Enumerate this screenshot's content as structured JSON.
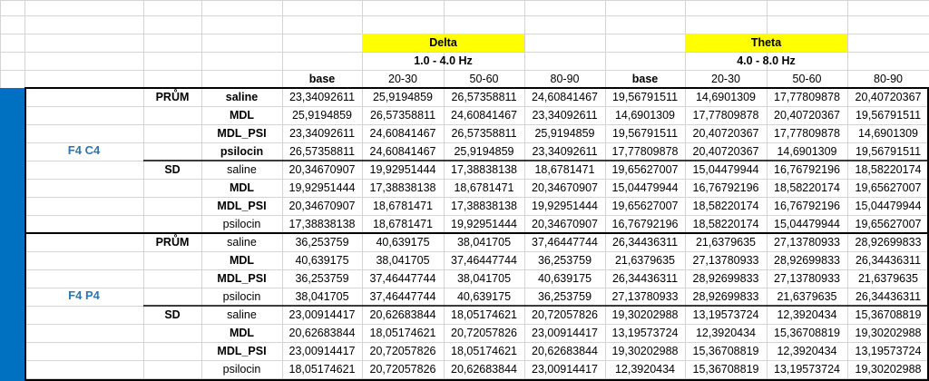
{
  "table": {
    "groups": [
      {
        "label": "Delta",
        "range": "1.0 - 4.0 Hz"
      },
      {
        "label": "Theta",
        "range": "4.0 - 8.0 Hz"
      }
    ],
    "columns": [
      "base",
      "20-30",
      "50-60",
      "80-90",
      "base",
      "20-30",
      "50-60",
      "80-90"
    ],
    "regions": [
      {
        "label": "F4 C4",
        "blocks": [
          {
            "stat": "PRŮM",
            "rows": [
              {
                "label": "saline",
                "values": [
                  "23,34092611",
                  "25,9194859",
                  "26,57358811",
                  "24,60841467",
                  "19,56791511",
                  "14,6901309",
                  "17,77809878",
                  "20,40720367"
                ]
              },
              {
                "label": "MDL",
                "values": [
                  "25,9194859",
                  "26,57358811",
                  "24,60841467",
                  "23,34092611",
                  "14,6901309",
                  "17,77809878",
                  "20,40720367",
                  "19,56791511"
                ]
              },
              {
                "label": "MDL_PSI",
                "values": [
                  "23,34092611",
                  "24,60841467",
                  "26,57358811",
                  "25,9194859",
                  "19,56791511",
                  "20,40720367",
                  "17,77809878",
                  "14,6901309"
                ]
              },
              {
                "label": "psilocin",
                "values": [
                  "26,57358811",
                  "24,60841467",
                  "25,9194859",
                  "23,34092611",
                  "17,77809878",
                  "20,40720367",
                  "14,6901309",
                  "19,56791511"
                ]
              }
            ]
          },
          {
            "stat": "SD",
            "rows": [
              {
                "label": "saline",
                "values": [
                  "20,34670907",
                  "19,92951444",
                  "17,38838138",
                  "18,6781471",
                  "19,65627007",
                  "15,04479944",
                  "16,76792196",
                  "18,58220174"
                ]
              },
              {
                "label": "MDL",
                "values": [
                  "19,92951444",
                  "17,38838138",
                  "18,6781471",
                  "20,34670907",
                  "15,04479944",
                  "16,76792196",
                  "18,58220174",
                  "19,65627007"
                ]
              },
              {
                "label": "MDL_PSI",
                "values": [
                  "20,34670907",
                  "18,6781471",
                  "17,38838138",
                  "19,92951444",
                  "19,65627007",
                  "18,58220174",
                  "16,76792196",
                  "15,04479944"
                ]
              },
              {
                "label": "psilocin",
                "values": [
                  "17,38838138",
                  "18,6781471",
                  "19,92951444",
                  "20,34670907",
                  "16,76792196",
                  "18,58220174",
                  "15,04479944",
                  "19,65627007"
                ]
              }
            ]
          }
        ]
      },
      {
        "label": "F4 P4",
        "blocks": [
          {
            "stat": "PRŮM",
            "rows": [
              {
                "label": "saline",
                "values": [
                  "36,253759",
                  "40,639175",
                  "38,041705",
                  "37,46447744",
                  "26,34436311",
                  "21,6379635",
                  "27,13780933",
                  "28,92699833"
                ]
              },
              {
                "label": "MDL",
                "values": [
                  "40,639175",
                  "38,041705",
                  "37,46447744",
                  "36,253759",
                  "21,6379635",
                  "27,13780933",
                  "28,92699833",
                  "26,34436311"
                ]
              },
              {
                "label": "MDL_PSI",
                "values": [
                  "36,253759",
                  "37,46447744",
                  "38,041705",
                  "40,639175",
                  "26,34436311",
                  "28,92699833",
                  "27,13780933",
                  "21,6379635"
                ]
              },
              {
                "label": "psilocin",
                "values": [
                  "38,041705",
                  "37,46447744",
                  "40,639175",
                  "36,253759",
                  "27,13780933",
                  "28,92699833",
                  "21,6379635",
                  "26,34436311"
                ]
              }
            ]
          },
          {
            "stat": "SD",
            "rows": [
              {
                "label": "saline",
                "values": [
                  "23,00914417",
                  "20,62683844",
                  "18,05174621",
                  "20,72057826",
                  "19,30202988",
                  "13,19573724",
                  "12,3920434",
                  "15,36708819"
                ]
              },
              {
                "label": "MDL",
                "values": [
                  "20,62683844",
                  "18,05174621",
                  "20,72057826",
                  "23,00914417",
                  "13,19573724",
                  "12,3920434",
                  "15,36708819",
                  "19,30202988"
                ]
              },
              {
                "label": "MDL_PSI",
                "values": [
                  "23,00914417",
                  "20,72057826",
                  "18,05174621",
                  "20,62683844",
                  "19,30202988",
                  "15,36708819",
                  "12,3920434",
                  "13,19573724"
                ]
              },
              {
                "label": "psilocin",
                "values": [
                  "18,05174621",
                  "20,72057826",
                  "20,62683844",
                  "23,00914417",
                  "12,3920434",
                  "15,36708819",
                  "13,19573724",
                  "19,30202988"
                ]
              }
            ]
          }
        ]
      }
    ]
  }
}
